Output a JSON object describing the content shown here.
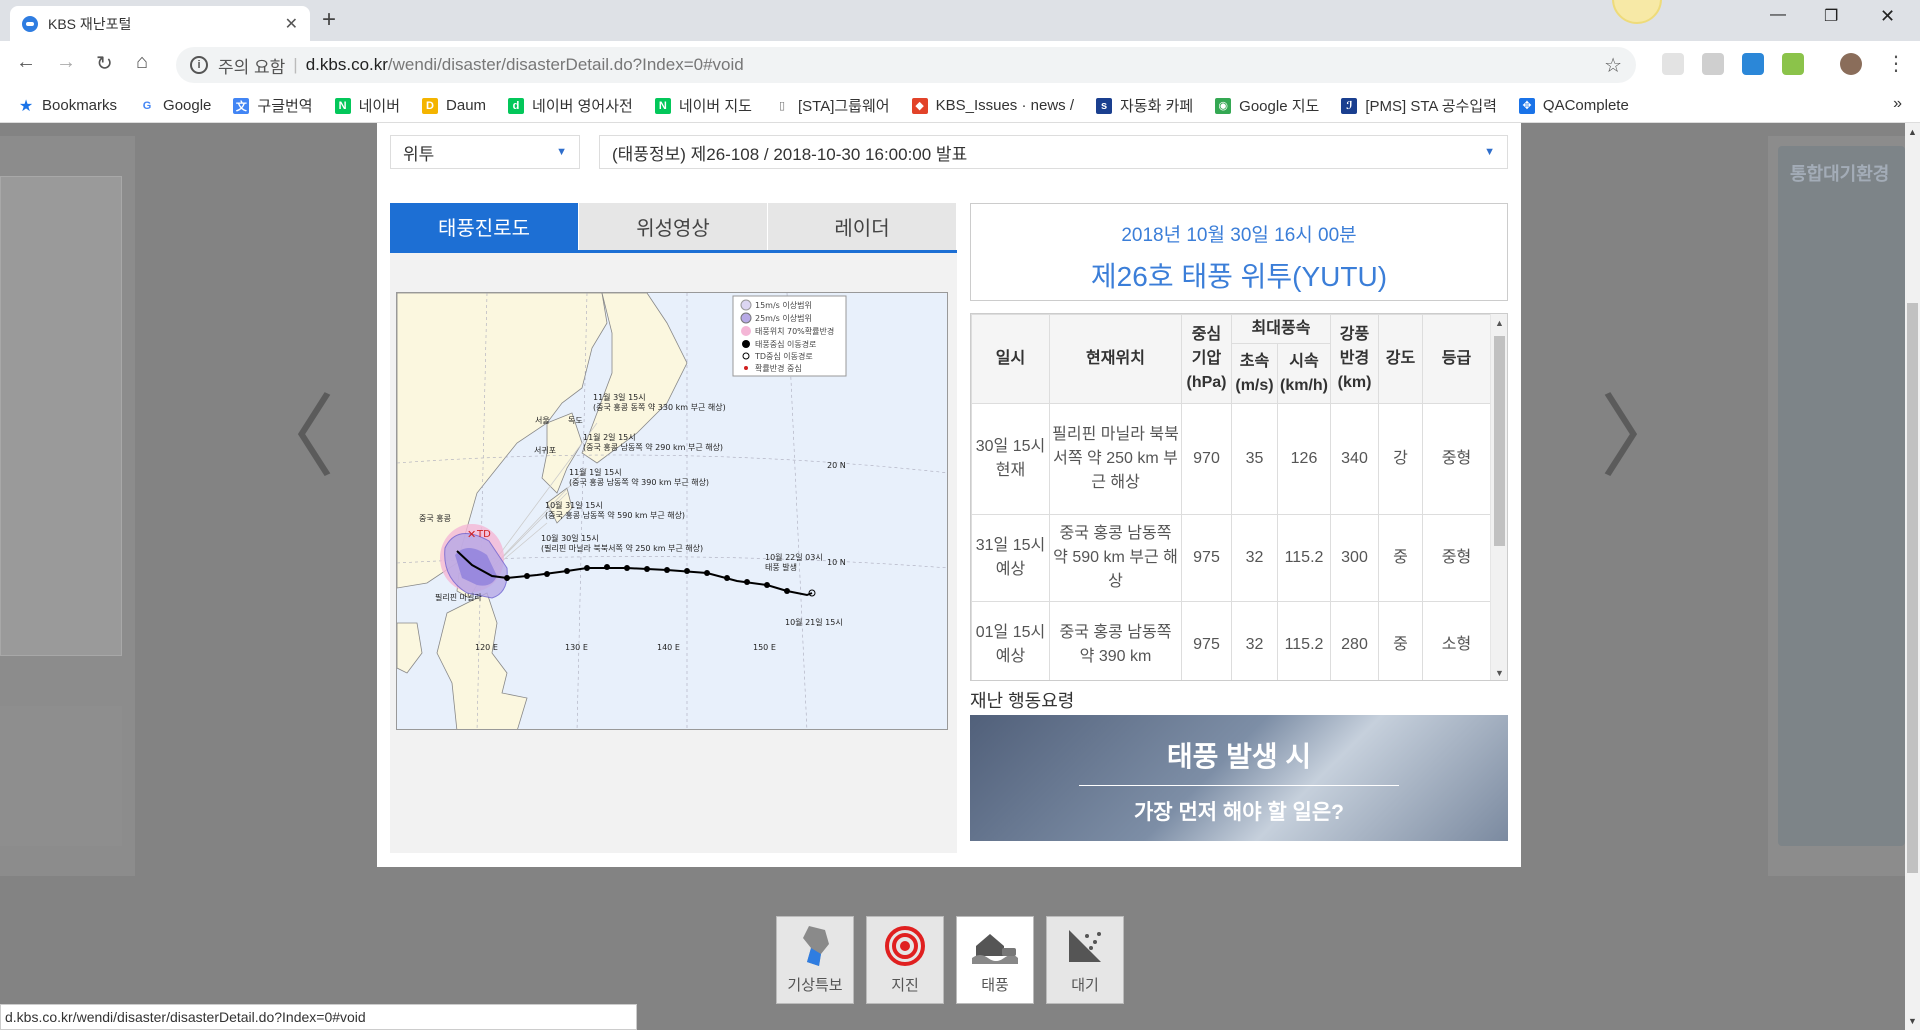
{
  "browser": {
    "tab_title": "KBS 재난포털",
    "security_label": "주의 요함",
    "url_host": "d.kbs.co.kr",
    "url_path": "/wendi/disaster/disasterDetail.do?Index=0#void",
    "status_url": "d.kbs.co.kr/wendi/disaster/disasterDetail.do?Index=0#void"
  },
  "bookmarks": [
    {
      "label": "Bookmarks",
      "icon": "star-icon",
      "color": "#1a73e8"
    },
    {
      "label": "Google",
      "icon": "google-icon",
      "color": "#4285f4"
    },
    {
      "label": "구글번역",
      "icon": "translate-icon",
      "color": "#4285f4"
    },
    {
      "label": "네이버",
      "icon": "naver-icon",
      "color": "#03c75a"
    },
    {
      "label": "Daum",
      "icon": "daum-icon",
      "color": "#f4b400"
    },
    {
      "label": "네이버 영어사전",
      "icon": "naver-dict-icon",
      "color": "#03c75a"
    },
    {
      "label": "네이버 지도",
      "icon": "naver-icon",
      "color": "#03c75a"
    },
    {
      "label": "[STA]그룹웨어",
      "icon": "document-icon",
      "color": "#777777"
    },
    {
      "label": "KBS_Issues · news / ",
      "icon": "gitlab-icon",
      "color": "#e24329"
    },
    {
      "label": "자동화 카페",
      "icon": "sta-icon",
      "color": "#1a3f8f"
    },
    {
      "label": "Google 지도",
      "icon": "maps-icon",
      "color": "#34a853"
    },
    {
      "label": "[PMS] STA 공수입력",
      "icon": "pms-icon",
      "color": "#1a3f8f"
    },
    {
      "label": "QAComplete",
      "icon": "qa-icon",
      "color": "#1a73e8"
    }
  ],
  "selectors": {
    "typhoon": "위투",
    "bulletin": "(태풍정보) 제26-108 / 2018-10-30 16:00:00 발표"
  },
  "tabs": [
    "태풍진로도",
    "위성영상",
    "레이더"
  ],
  "map": {
    "legend": [
      "15m/s 이상범위",
      "25m/s 이상범위",
      "태풍위치 70%확률반경",
      "태풍중심 이동경로",
      "TD중심 이동경로",
      "확률반경 중심"
    ],
    "labels": {
      "nov3": "11월 3일 15시",
      "nov3_desc": "(중국 홍콩 동쪽 약 330 km 부근 해상)",
      "nov2": "11월 2일 15시",
      "nov2_desc": "(중국 홍콩 남동쪽 약 290 km 부근 해상)",
      "nov1": "11월 1일 15시",
      "nov1_desc": "(중국 홍콩 남동쪽 약 390 km 부근 해상)",
      "oct31": "10월 31일 15시",
      "oct31_desc": "(중국 홍콩 남동쪽 약 590 km 부근 해상)",
      "oct30": "10월 30일 15시",
      "oct30_desc": "(필리핀 마닐라 북북서쪽 약 250 km 부근 해상)",
      "oct22": "10월 22일 03시",
      "oct22_desc": "태풍 발생",
      "oct21": "10월 21일 15시",
      "seoul": "서울",
      "dokdo": "독도",
      "seogwipo": "서귀포",
      "hongkong": "중국 홍콩",
      "manila": "필리핀 마닐라",
      "td": "TD",
      "lat20": "20 N",
      "lat10": "10 N",
      "lon120": "120 E",
      "lon130": "130 E",
      "lon140": "140 E",
      "lon150": "150 E"
    }
  },
  "info": {
    "datetime": "2018년 10월 30일 16시 00분",
    "name": "제26호 태풍 위투(YUTU)"
  },
  "table": {
    "headers": {
      "time": "일시",
      "location": "현재위치",
      "pressure": "중심 기압 (hPa)",
      "max_wind": "최대풍속",
      "wind_ms": "초속 (m/s)",
      "wind_kmh": "시속 (km/h)",
      "radius": "강풍 반경 (km)",
      "strength": "강도",
      "size": "등급"
    },
    "rows": [
      {
        "time": "30일 15시 현재",
        "location": "필리핀 마닐라 북북서쪽 약 250 km 부근 해상",
        "pressure": "970",
        "ms": "35",
        "kmh": "126",
        "radius": "340",
        "strength": "강",
        "size": "중형"
      },
      {
        "time": "31일 15시 예상",
        "location": "중국 홍콩 남동쪽 약 590 km 부근 해상",
        "pressure": "975",
        "ms": "32",
        "kmh": "115.2",
        "radius": "300",
        "strength": "중",
        "size": "중형"
      },
      {
        "time": "01일 15시 예상",
        "location": "중국 홍콩 남동쪽 약 390 km",
        "pressure": "975",
        "ms": "32",
        "kmh": "115.2",
        "radius": "280",
        "strength": "중",
        "size": "소형"
      }
    ]
  },
  "guide": {
    "title": "재난 행동요령",
    "banner_main": "태풍 발생 시",
    "banner_sub": "가장 먼저 해야 할 일은?"
  },
  "categories": [
    "기상특보",
    "지진",
    "태풍",
    "대기"
  ],
  "background": {
    "right_title": "통합대기환경"
  }
}
